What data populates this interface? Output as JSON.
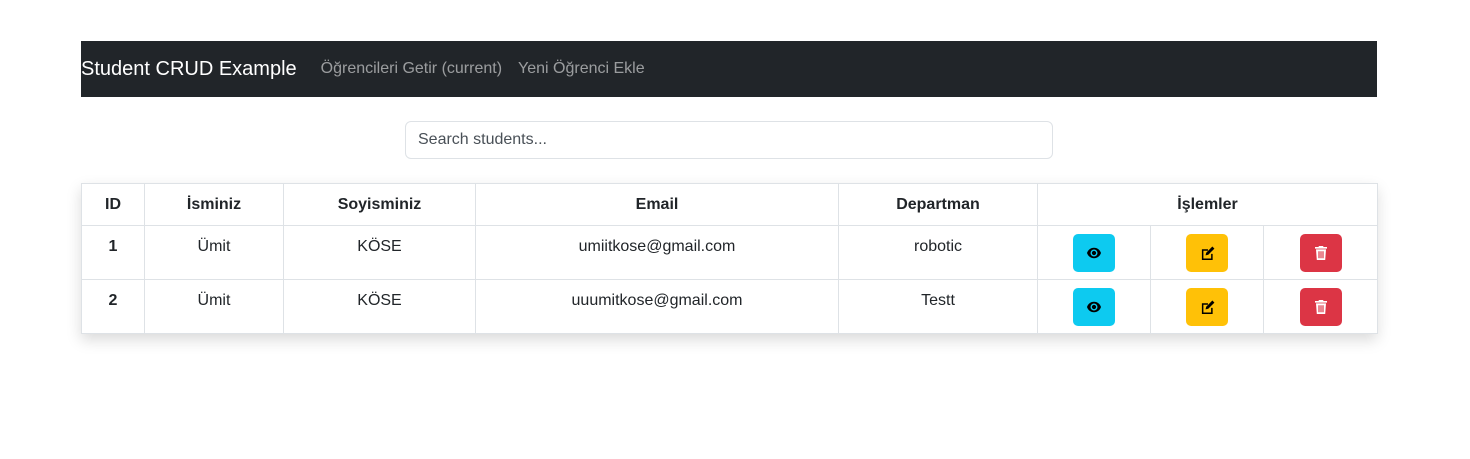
{
  "navbar": {
    "brand": "Student CRUD Example",
    "links": [
      {
        "label": "Öğrencileri Getir (current)"
      },
      {
        "label": "Yeni Öğrenci Ekle"
      }
    ]
  },
  "search": {
    "placeholder": "Search students..."
  },
  "table": {
    "headers": {
      "id": "ID",
      "first_name": "İsminiz",
      "last_name": "Soyisminiz",
      "email": "Email",
      "department": "Departman",
      "actions": "İşlemler"
    },
    "rows": [
      {
        "id": "1",
        "first_name": "Ümit",
        "last_name": "KÖSE",
        "email": "umiitkose@gmail.com",
        "department": "robotic"
      },
      {
        "id": "2",
        "first_name": "Ümit",
        "last_name": "KÖSE",
        "email": "uuumitkose@gmail.com",
        "department": "Testt"
      }
    ],
    "action_icons": {
      "view": "eye-icon",
      "edit": "edit-icon",
      "delete": "trash-icon"
    }
  },
  "colors": {
    "navbar_bg": "#212529",
    "view_button": "#0dcaf0",
    "edit_button": "#ffc107",
    "delete_button": "#dc3545"
  }
}
